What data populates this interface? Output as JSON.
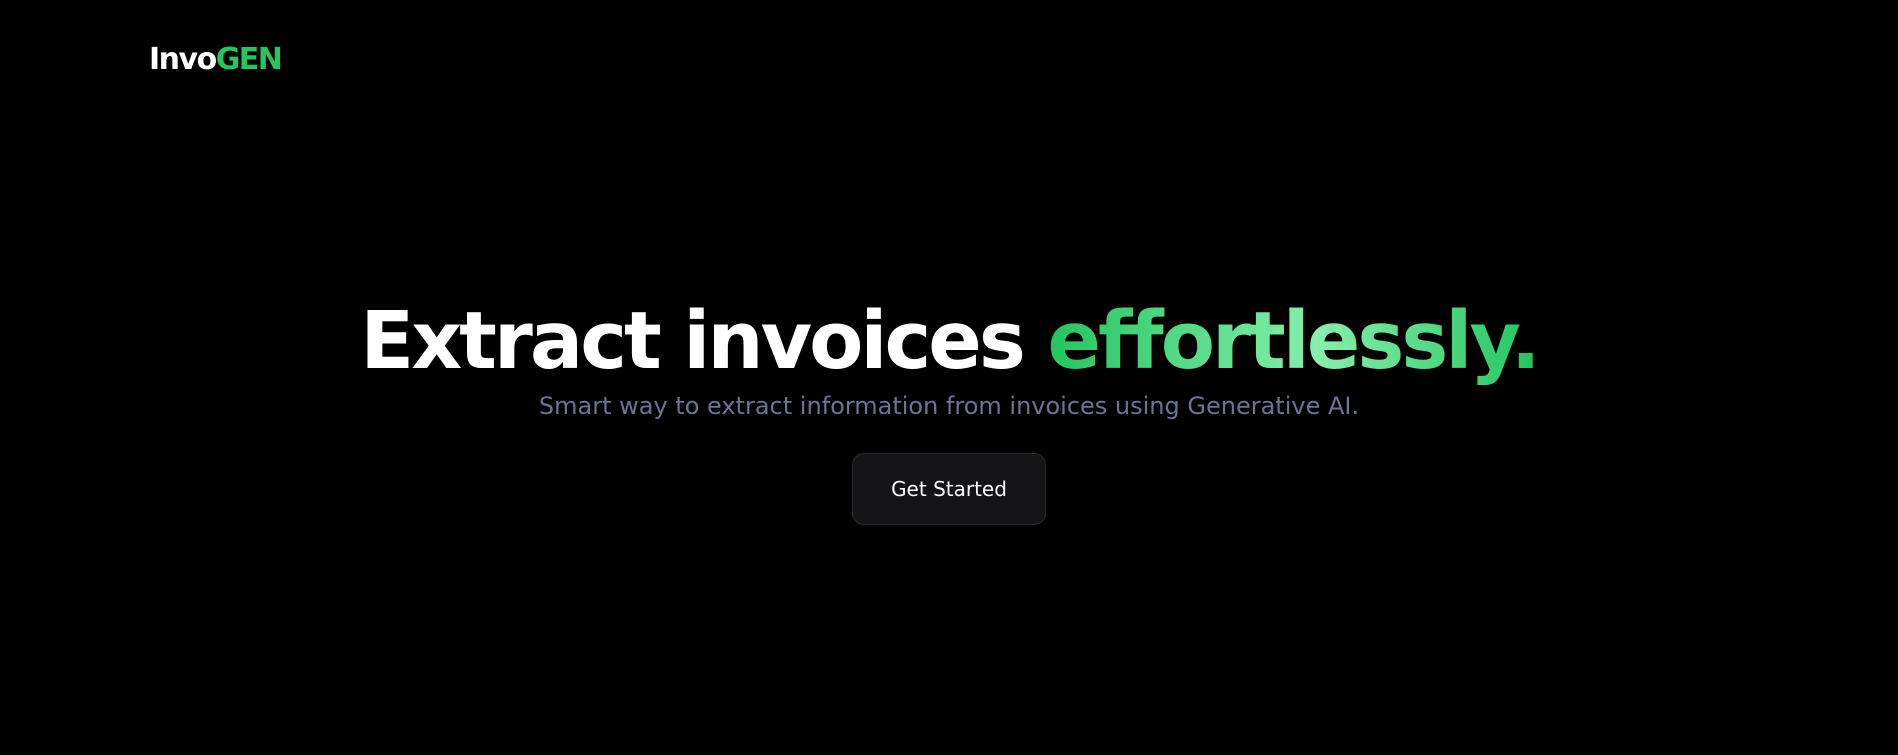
{
  "brand": {
    "logo_part_a": "Invo",
    "logo_part_b": "GEN",
    "accent_color": "#22c55e"
  },
  "hero": {
    "headline_main": "Extract invoices ",
    "headline_accent": "effortlessly.",
    "subtitle": "Smart way to extract information from invoices using Generative AI.",
    "cta_label": "Get Started"
  }
}
